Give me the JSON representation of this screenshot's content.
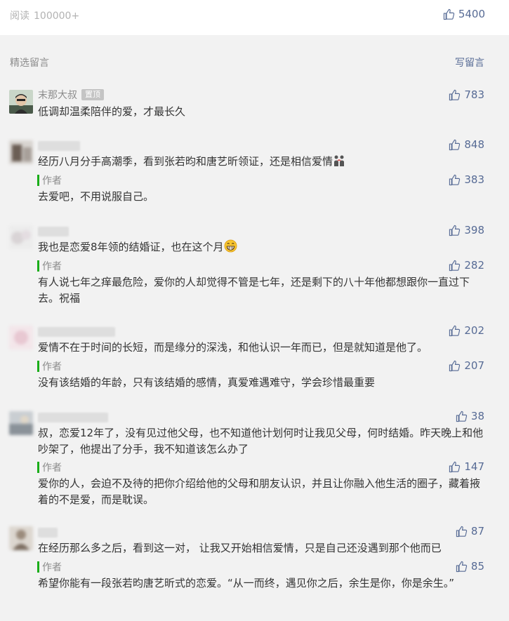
{
  "top": {
    "read_label": "阅读",
    "read_count": "100000+",
    "like_count": "5400"
  },
  "section": {
    "title": "精选留言",
    "write_label": "写留言"
  },
  "author_label": "作者",
  "pin_label": "置顶",
  "comments": [
    {
      "name": "末那大叔",
      "text": "低调却温柔陪伴的爱，才最长久",
      "likes": "783"
    },
    {
      "name": "",
      "text": "经历八月分手高潮季，看到张若昀和唐艺昕领证，还是相信爱情",
      "likes": "848",
      "reply": "去爱吧，不用说服自己。",
      "reply_likes": "383"
    },
    {
      "name": "",
      "text": "我也是恋爱8年领的结婚证，也在这个月",
      "likes": "398",
      "reply": "有人说七年之痒最危险，爱你的人却觉得不管是七年，还是剩下的八十年他都想跟你一直过下去。祝福",
      "reply_likes": "282"
    },
    {
      "name": "",
      "text": "爱情不在于时间的长短，而是缘分的深浅，和他认识一年而已，但是就知道是他了。",
      "likes": "202",
      "reply": "没有该结婚的年龄，只有该结婚的感情，真爱难遇难守，学会珍惜最重要",
      "reply_likes": "207"
    },
    {
      "name": "",
      "text": "叔，恋爱12年了，没有见过他父母，也不知道他计划何时让我见父母，何时结婚。昨天晚上和他吵架了，他提出了分手，我不知道该怎么办了",
      "likes": "38",
      "reply": "爱你的人，会迫不及待的把你介绍给他的父母和朋友认识，并且让你融入他生活的圈子，藏着掖着的不是爱，而是耽误。",
      "reply_likes": "147"
    },
    {
      "name": "",
      "text": "在经历那么多之后，看到这一对， 让我又开始相信爱情，只是自己还没遇到那个他而已",
      "likes": "87",
      "reply": "希望你能有一段张若昀唐艺昕式的恋爱。“从一而终，遇见你之后，余生是你，你是余生。”",
      "reply_likes": "85"
    }
  ],
  "colors": {
    "link": "#576b95",
    "author_bar": "#1aad19",
    "muted": "#8c8c8c",
    "background": "#f2f2f2"
  }
}
